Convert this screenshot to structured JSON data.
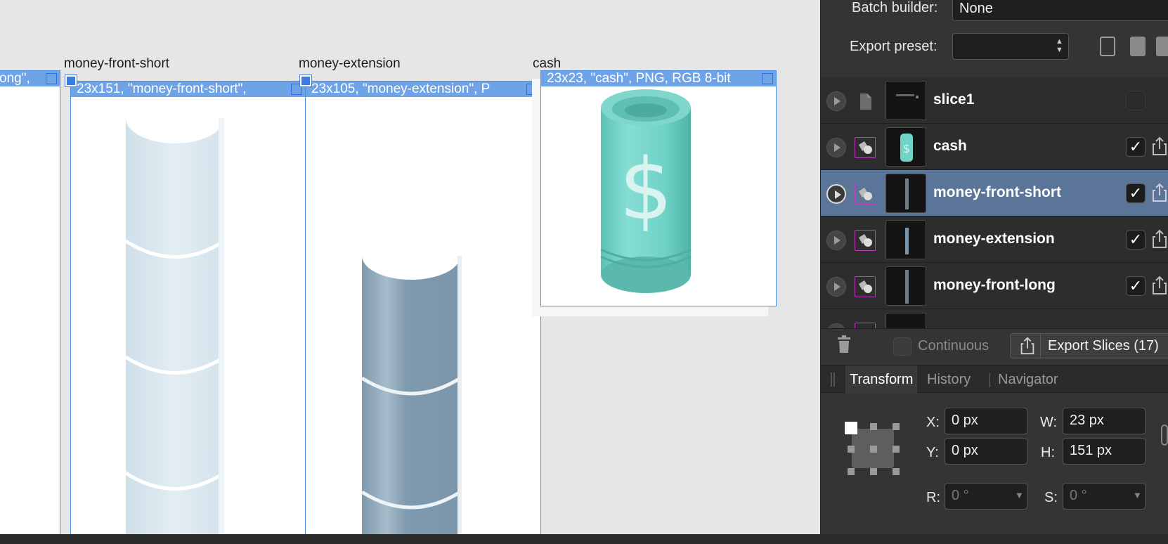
{
  "canvas": {
    "slices": {
      "partial_label": "ong\",",
      "money_front_short": {
        "title": "money-front-short",
        "info": "23x151, \"money-front-short\","
      },
      "money_extension": {
        "title": "money-extension",
        "info": "23x105, \"money-extension\", P"
      },
      "cash": {
        "title": "cash",
        "info": "23x23, \"cash\", PNG, RGB 8-bit"
      }
    }
  },
  "panel": {
    "batch_builder_label": "Batch builder:",
    "batch_builder_value": "None",
    "export_preset_label": "Export preset:",
    "export_preset_value": "",
    "layers": [
      {
        "name": "slice1",
        "checked": false
      },
      {
        "name": "cash",
        "checked": true
      },
      {
        "name": "money-front-short",
        "checked": true
      },
      {
        "name": "money-extension",
        "checked": true
      },
      {
        "name": "money-front-long",
        "checked": true
      }
    ],
    "continuous_label": "Continuous",
    "export_button": "Export Slices (17)",
    "tabs": [
      "Transform",
      "History",
      "Navigator"
    ],
    "transform": {
      "x_label": "X:",
      "x_value": "0 px",
      "y_label": "Y:",
      "y_value": "0 px",
      "w_label": "W:",
      "w_value": "23 px",
      "h_label": "H:",
      "h_value": "151 px",
      "r_label": "R:",
      "r_value": "0 °",
      "s_label": "S:",
      "s_value": "0 °"
    }
  },
  "colors": {
    "selection_blue": "#4a90e2",
    "selected_row": "#5a7598",
    "cash_teal": "#6fd3c8"
  }
}
